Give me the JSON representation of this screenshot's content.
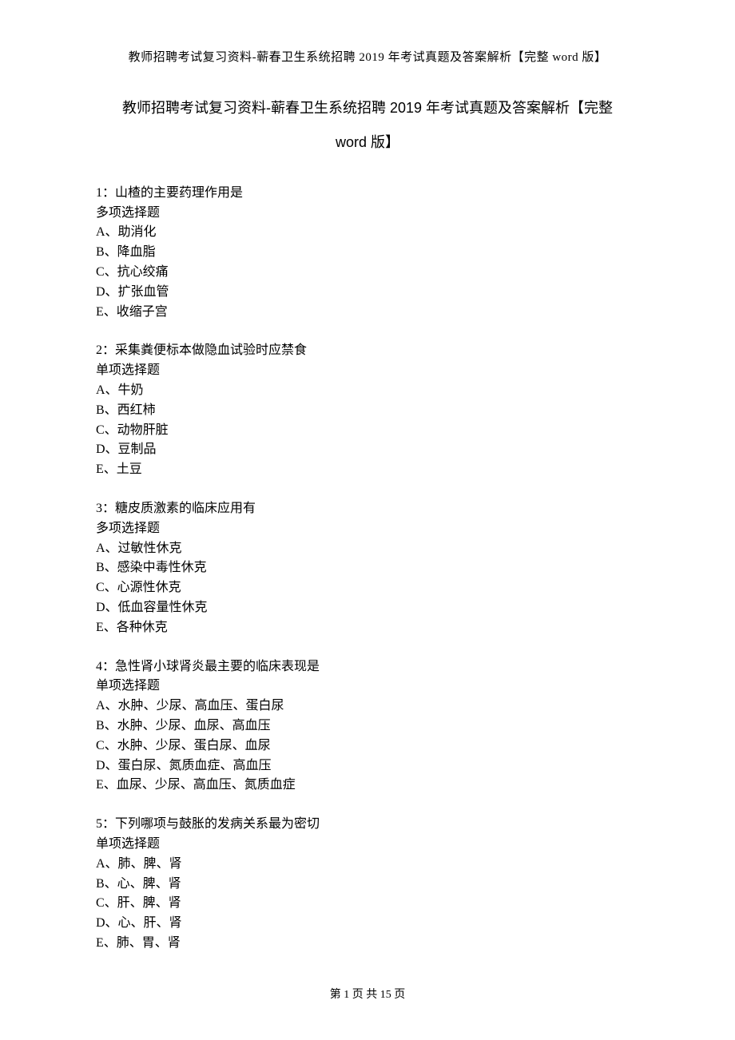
{
  "running_header": "教师招聘考试复习资料-蕲春卫生系统招聘 2019 年考试真题及答案解析【完整 word 版】",
  "main_title_line1": "教师招聘考试复习资料-蕲春卫生系统招聘 2019 年考试真题及答案解析【完整",
  "main_title_line2": "word 版】",
  "questions": [
    {
      "stem": "1：山楂的主要药理作用是",
      "type": "多项选择题",
      "options": [
        "A、助消化",
        "B、降血脂",
        "C、抗心绞痛",
        "D、扩张血管",
        "E、收缩子宫"
      ]
    },
    {
      "stem": "2：采集粪便标本做隐血试验时应禁食",
      "type": "单项选择题",
      "options": [
        "A、牛奶",
        "B、西红柿",
        "C、动物肝脏",
        "D、豆制品",
        "E、土豆"
      ]
    },
    {
      "stem": "3：糖皮质激素的临床应用有",
      "type": "多项选择题",
      "options": [
        "A、过敏性休克",
        "B、感染中毒性休克",
        "C、心源性休克",
        "D、低血容量性休克",
        "E、各种休克"
      ]
    },
    {
      "stem": "4：急性肾小球肾炎最主要的临床表现是",
      "type": "单项选择题",
      "options": [
        "A、水肿、少尿、高血压、蛋白尿",
        "B、水肿、少尿、血尿、高血压",
        "C、水肿、少尿、蛋白尿、血尿",
        "D、蛋白尿、氮质血症、高血压",
        "E、血尿、少尿、高血压、氮质血症"
      ]
    },
    {
      "stem": "5：下列哪项与鼓胀的发病关系最为密切",
      "type": "单项选择题",
      "options": [
        "A、肺、脾、肾",
        "B、心、脾、肾",
        "C、肝、脾、肾",
        "D、心、肝、肾",
        "E、肺、胃、肾"
      ]
    }
  ],
  "footer": {
    "prefix": "第 ",
    "current": "1",
    "middle": " 页 共 ",
    "total": "15",
    "suffix": " 页"
  }
}
